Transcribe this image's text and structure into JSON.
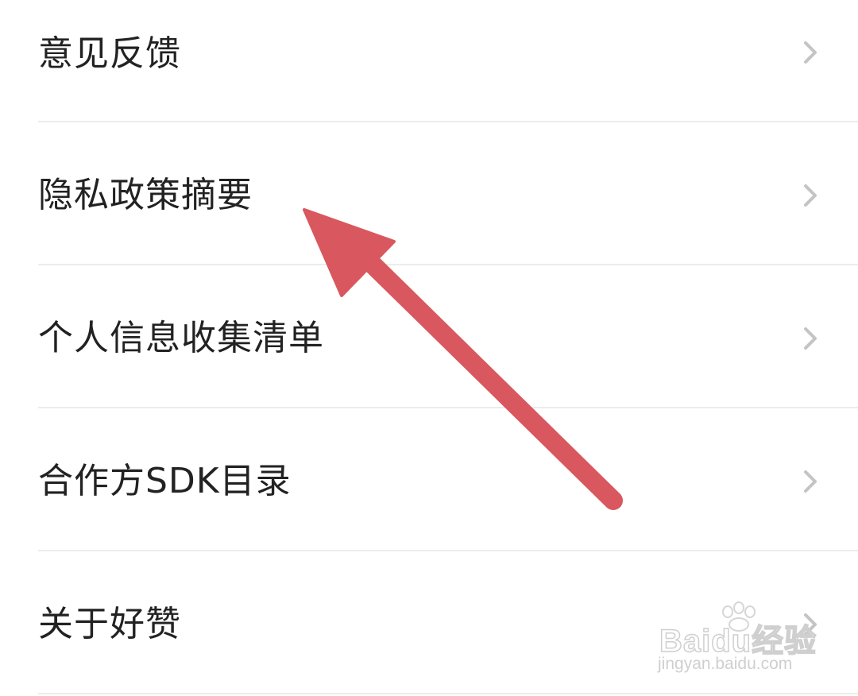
{
  "settings": {
    "items": [
      {
        "label": "意见反馈"
      },
      {
        "label": "隐私政策摘要"
      },
      {
        "label": "个人信息收集清单"
      },
      {
        "label": "合作方SDK目录"
      },
      {
        "label": "关于好赞"
      }
    ]
  },
  "annotation": {
    "arrow_color": "#d9575e",
    "arrow_target": "隐私政策摘要"
  },
  "watermark": {
    "logo": "Baidu经验",
    "url": "jingyan.baidu.com"
  },
  "colors": {
    "text": "#222222",
    "chevron": "#c4c4c4",
    "divider": "#ececec",
    "background": "#ffffff"
  }
}
